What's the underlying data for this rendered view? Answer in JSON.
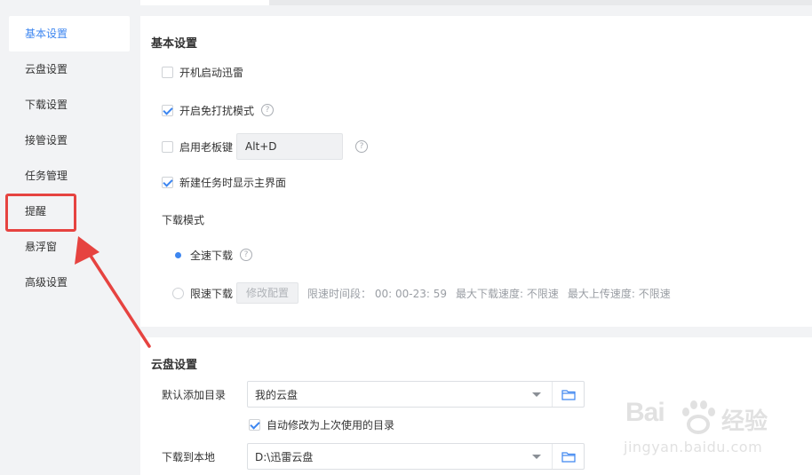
{
  "sidebar": {
    "items": [
      {
        "label": "基本设置",
        "active": true
      },
      {
        "label": "云盘设置",
        "active": false
      },
      {
        "label": "下载设置",
        "active": false
      },
      {
        "label": "接管设置",
        "active": false
      },
      {
        "label": "任务管理",
        "active": false
      },
      {
        "label": "提醒",
        "active": false
      },
      {
        "label": "悬浮窗",
        "active": false
      },
      {
        "label": "高级设置",
        "active": false
      }
    ]
  },
  "basic": {
    "title": "基本设置",
    "autostart_label": "开机启动迅雷",
    "autostart_checked": false,
    "nodisturb_label": "开启免打扰模式",
    "nodisturb_checked": true,
    "bosskey_label": "启用老板键",
    "bosskey_checked": false,
    "bosskey_value": "Alt+D",
    "show_main_label": "新建任务时显示主界面",
    "show_main_checked": true,
    "download_mode_label": "下载模式",
    "full_speed_label": "全速下载",
    "full_speed_selected": true,
    "limit_speed_label": "限速下载",
    "limit_speed_selected": false,
    "modify_button": "修改配置",
    "limit_period": "限速时间段： 00: 00-23: 59",
    "max_download": "最大下载速度: 不限速",
    "max_upload": "最大上传速度: 不限速",
    "help_glyph": "?"
  },
  "cloud": {
    "title": "云盘设置",
    "default_dir_label": "默认添加目录",
    "default_dir_value": "我的云盘",
    "auto_modify_label": "自动修改为上次使用的目录",
    "auto_modify_checked": true,
    "download_local_label": "下载到本地",
    "download_local_value": "D:\\迅雷云盘"
  },
  "watermark": {
    "brand": "Bai",
    "brand2": "经验",
    "url": "jingyan.baidu.com"
  },
  "colors": {
    "accent": "#3d86f0",
    "highlight": "#e64340"
  },
  "icons": {
    "folder": "folder-icon",
    "help": "help-icon",
    "caret": "chevron-down-icon",
    "arrow": "annotation-arrow"
  }
}
